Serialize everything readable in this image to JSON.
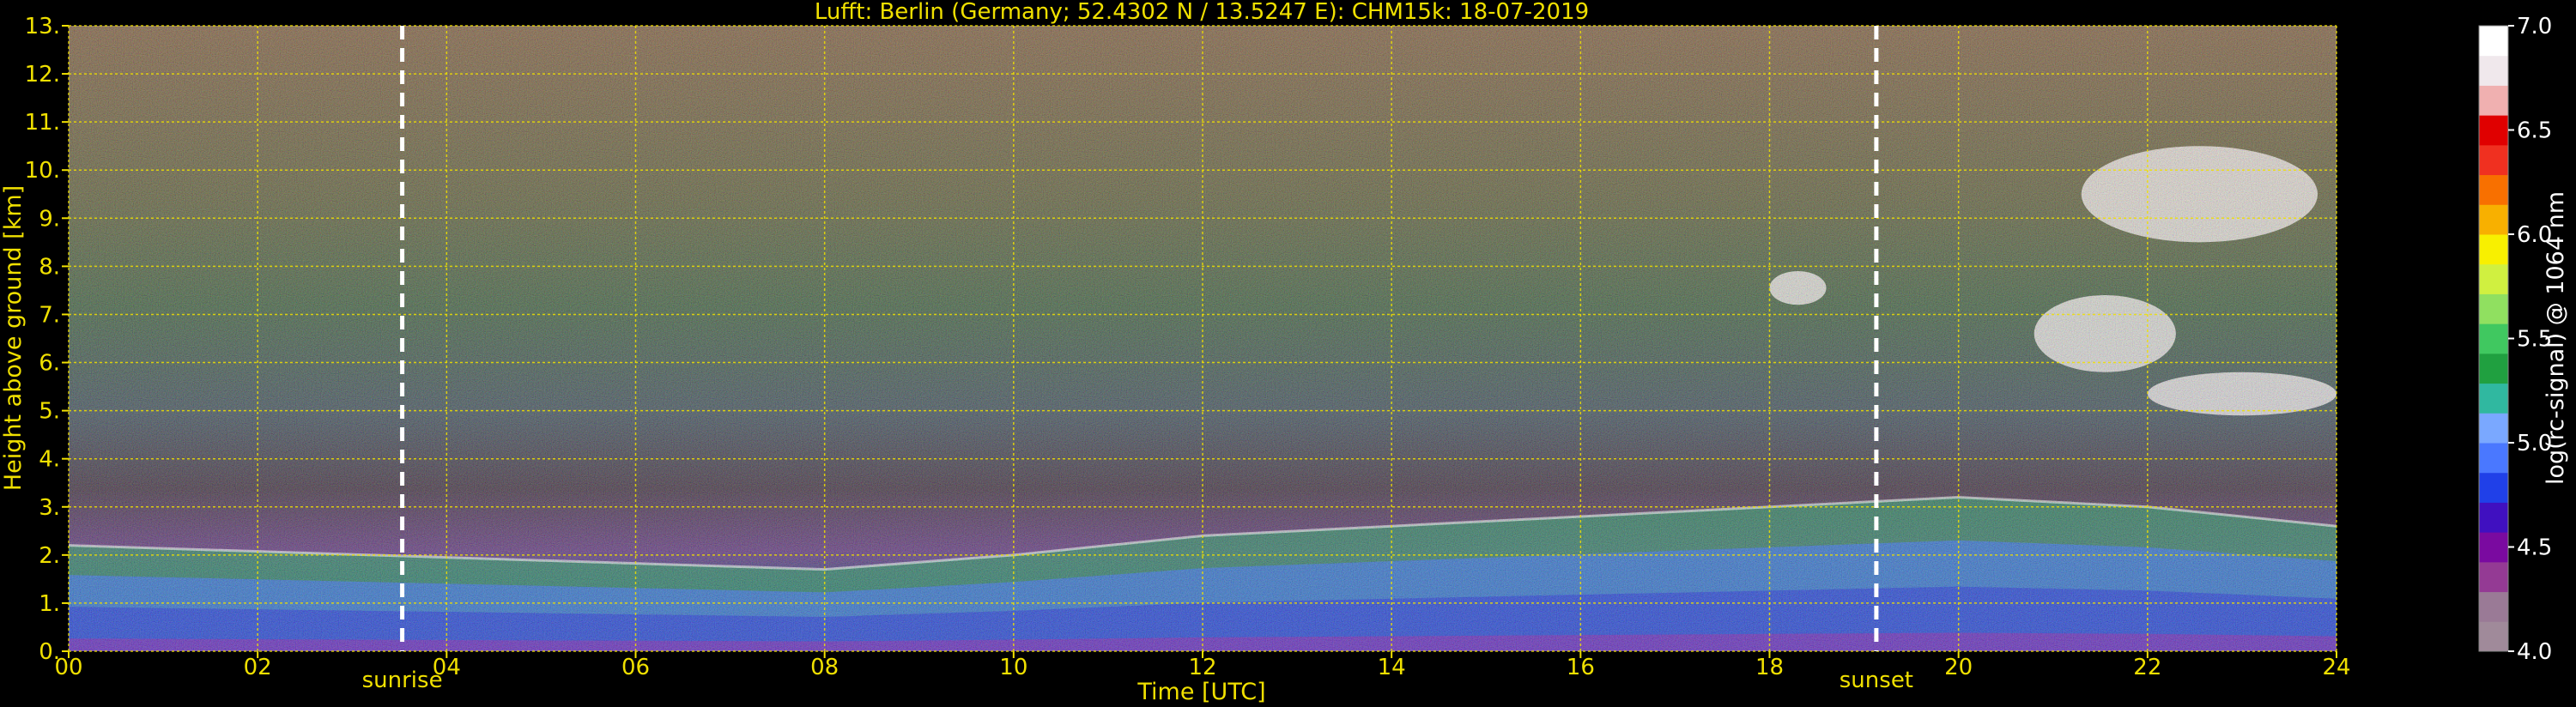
{
  "chart_data": {
    "type": "heatmap",
    "title": "Lufft: Berlin (Germany; 52.4302 N / 13.5247 E):    CHM15k: 18-07-2019",
    "xlabel": "Time [UTC]",
    "ylabel": "Height above ground [km]",
    "x_ticks": [
      "00",
      "02",
      "04",
      "06",
      "08",
      "10",
      "12",
      "14",
      "16",
      "18",
      "20",
      "22",
      "24"
    ],
    "y_ticks": [
      "0.",
      "1.",
      "2.",
      "3.",
      "4.",
      "5.",
      "6.",
      "7.",
      "8.",
      "9.",
      "10.",
      "11.",
      "12.",
      "13."
    ],
    "xlim": [
      0,
      24
    ],
    "ylim": [
      0,
      13
    ],
    "grid": true,
    "grid_color": "#f0e000",
    "axis_text_color": "#f0e000",
    "colorbar": {
      "label": "log(rc-signal) @ 1064 nm",
      "range": [
        4.0,
        7.0
      ],
      "ticks": [
        "4.0",
        "4.5",
        "5.0",
        "5.5",
        "6.0",
        "6.5",
        "7.0"
      ],
      "colors": [
        "#a08a9a",
        "#9a7a96",
        "#943a94",
        "#7a0aa0",
        "#4010c0",
        "#2040e8",
        "#4a78ff",
        "#7aa8ff",
        "#30b8a0",
        "#20a040",
        "#40c860",
        "#90e060",
        "#d0f040",
        "#f8f000",
        "#f8b000",
        "#f87000",
        "#f03020",
        "#e00000",
        "#f0b0b0",
        "#f0e8ec",
        "#ffffff"
      ]
    },
    "events": [
      {
        "label": "sunrise",
        "time": 3.53
      },
      {
        "label": "sunset",
        "time": 19.13
      }
    ],
    "boundary_layer_top_km": [
      {
        "time": 0,
        "height": 2.2
      },
      {
        "time": 8,
        "height": 1.7
      },
      {
        "time": 10,
        "height": 2.0
      },
      {
        "time": 12,
        "height": 2.4
      },
      {
        "time": 14,
        "height": 2.6
      },
      {
        "time": 16,
        "height": 2.8
      },
      {
        "time": 18,
        "height": 3.0
      },
      {
        "time": 20,
        "height": 3.2
      },
      {
        "time": 22,
        "height": 3.0
      },
      {
        "time": 24,
        "height": 2.6
      }
    ],
    "cloud_features": [
      {
        "time_start": 18.0,
        "time_end": 18.6,
        "height_bottom": 7.2,
        "height_top": 7.9
      },
      {
        "time_start": 20.8,
        "time_end": 22.3,
        "height_bottom": 5.8,
        "height_top": 7.4
      },
      {
        "time_start": 22.0,
        "time_end": 24.0,
        "height_bottom": 4.9,
        "height_top": 5.8
      },
      {
        "time_start": 21.3,
        "time_end": 23.8,
        "height_bottom": 8.5,
        "height_top": 10.5
      }
    ]
  }
}
